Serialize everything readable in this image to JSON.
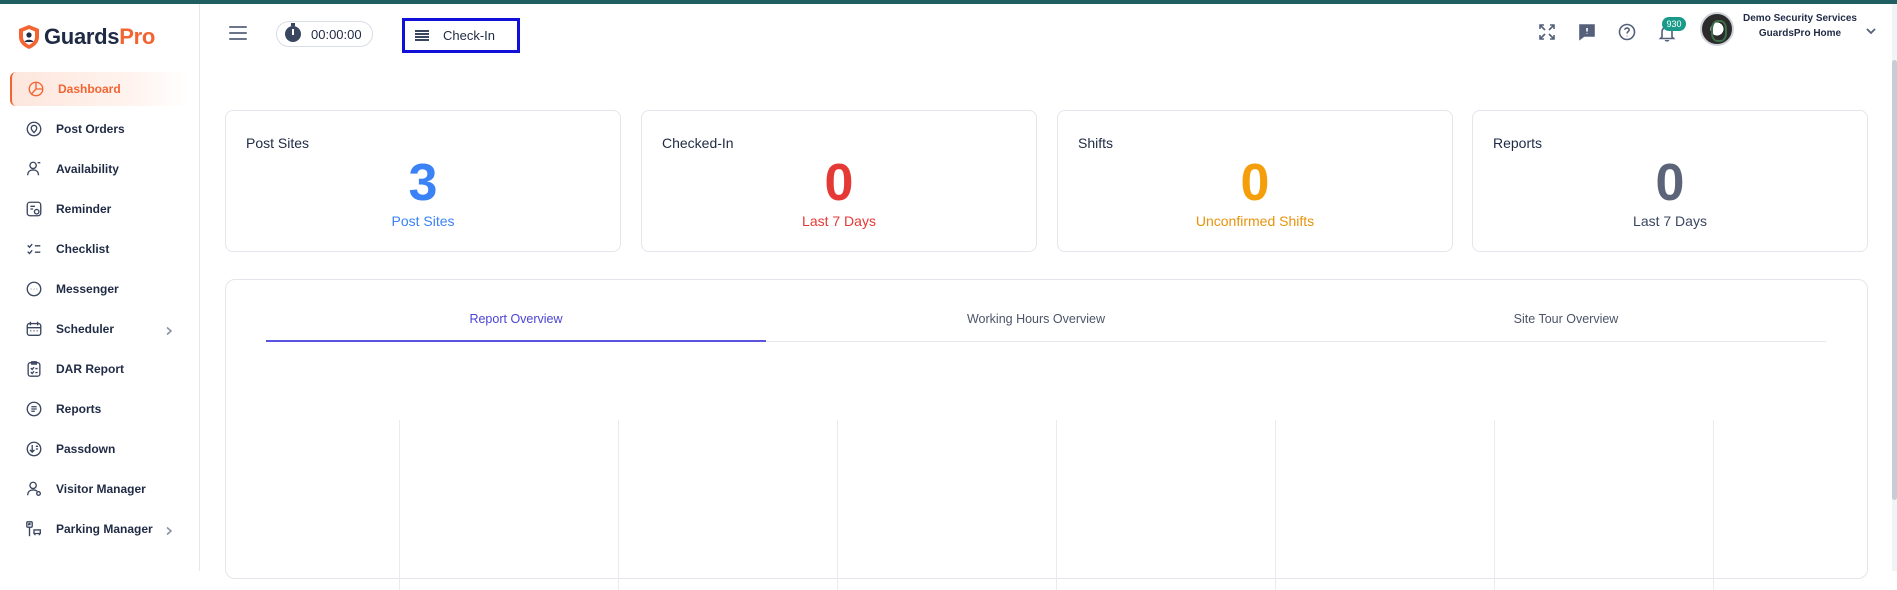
{
  "brand": {
    "name_part1": "Guards",
    "name_part2": "Pro",
    "accent": "#f26532"
  },
  "sidebar": {
    "items": [
      {
        "label": "Dashboard",
        "icon": "dashboard-icon",
        "active": true
      },
      {
        "label": "Post Orders",
        "icon": "post-orders-icon"
      },
      {
        "label": "Availability",
        "icon": "availability-icon"
      },
      {
        "label": "Reminder",
        "icon": "reminder-icon"
      },
      {
        "label": "Checklist",
        "icon": "checklist-icon"
      },
      {
        "label": "Messenger",
        "icon": "messenger-icon"
      },
      {
        "label": "Scheduler",
        "icon": "scheduler-icon",
        "has_submenu": true
      },
      {
        "label": "DAR Report",
        "icon": "dar-report-icon"
      },
      {
        "label": "Reports",
        "icon": "reports-icon"
      },
      {
        "label": "Passdown",
        "icon": "passdown-icon"
      },
      {
        "label": "Visitor Manager",
        "icon": "visitor-manager-icon"
      },
      {
        "label": "Parking Manager",
        "icon": "parking-manager-icon",
        "has_submenu": true
      }
    ]
  },
  "header": {
    "timer": "00:00:00",
    "checkin_label": "Check-In",
    "notification_count": "930",
    "company_name": "Demo Security Services",
    "location_name": "GuardsPro Home"
  },
  "cards": [
    {
      "title": "Post Sites",
      "value": "3",
      "subtitle": "Post Sites",
      "color": "#3b82f6"
    },
    {
      "title": "Checked-In",
      "value": "0",
      "subtitle": "Last 7 Days",
      "color": "#e53935"
    },
    {
      "title": "Shifts",
      "value": "0",
      "subtitle": "Unconfirmed Shifts",
      "color": "#f59e0b"
    },
    {
      "title": "Reports",
      "value": "0",
      "subtitle": "Last 7 Days",
      "color": "#5b6478"
    }
  ],
  "overview": {
    "tabs": [
      {
        "label": "Report Overview",
        "active": true
      },
      {
        "label": "Working Hours Overview"
      },
      {
        "label": "Site Tour Overview"
      }
    ]
  }
}
